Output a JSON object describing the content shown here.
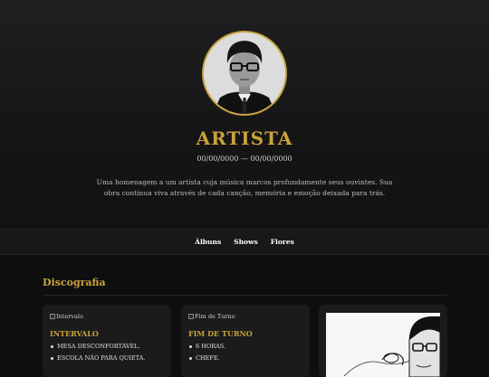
{
  "hero": {
    "name": "ARTISTA",
    "dates": "00/00/0000 — 00/00/0000",
    "bio": "Uma homenagem a um artista cuja música marcos profundamente seus ouvintes. Sua obra continua viva através de cada canção, memória e emoção deixada para trás."
  },
  "nav": {
    "items": [
      "Álbuns",
      "Shows",
      "Flores"
    ]
  },
  "discography": {
    "title": "Discografia",
    "albums": [
      {
        "alt": "Intervalo",
        "title": "INTERVALO",
        "tracks": [
          "MESA DESCONFORTÁVEL.",
          "ESCOLA NÃO PARA QUIETA."
        ]
      },
      {
        "alt": "Fim de Turno",
        "title": "FIM DE TURNO",
        "tracks": [
          "6 HORAS.",
          "CHEFE."
        ]
      }
    ]
  },
  "colors": {
    "accent": "#c9a23c",
    "background": "#0e0e0e",
    "card": "#1b1b1b"
  }
}
